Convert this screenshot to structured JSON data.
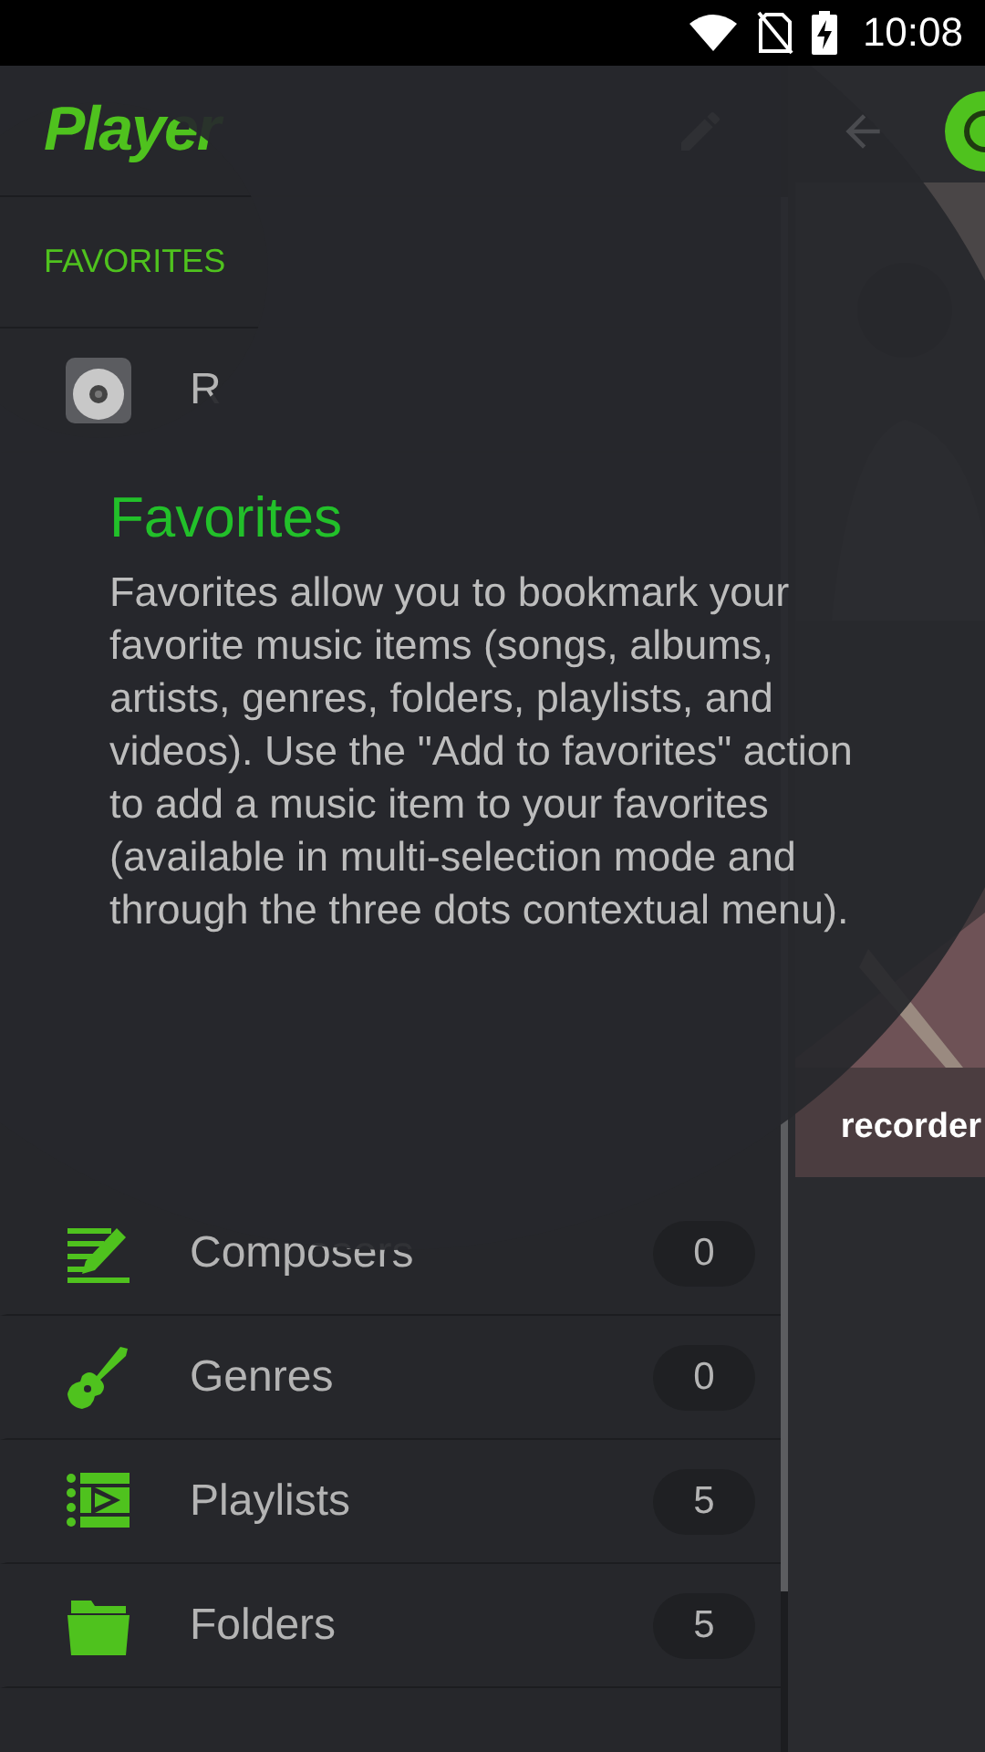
{
  "status_bar": {
    "time": "10:08"
  },
  "drawer": {
    "logo": "Player",
    "favorites": {
      "title": "FAVORITES",
      "items": [
        {
          "label": "R"
        }
      ]
    },
    "browse_items": [
      {
        "label": "Composers",
        "count": "0"
      },
      {
        "label": "Genres",
        "count": "0"
      },
      {
        "label": "Playlists",
        "count": "5"
      },
      {
        "label": "Folders",
        "count": "5"
      }
    ]
  },
  "content": {
    "tiles": [
      {
        "kind": "picture",
        "caption": "recorder"
      }
    ]
  },
  "tutorial": {
    "title": "Favorites",
    "text": "Favorites allow you to bookmark your favorite music items (songs, albums, artists, genres, folders, playlists, and videos). Use the \"Add to favorites\" action to add a music item to your favorites (available in multi-selection mode and through the three dots contextual menu)."
  }
}
